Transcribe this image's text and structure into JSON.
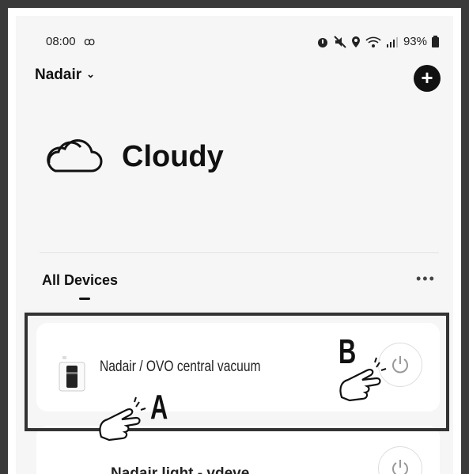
{
  "status_bar": {
    "time": "08:00",
    "battery": "93%"
  },
  "header": {
    "home_name": "Nadair"
  },
  "weather": {
    "condition": "Cloudy"
  },
  "devices": {
    "section_title": "All Devices",
    "items": [
      {
        "name": "Nadair / OVO central vacuum"
      },
      {
        "name": "Nadair light - vdeve"
      }
    ]
  },
  "annotations": {
    "label_a": "A",
    "label_b": "B"
  }
}
